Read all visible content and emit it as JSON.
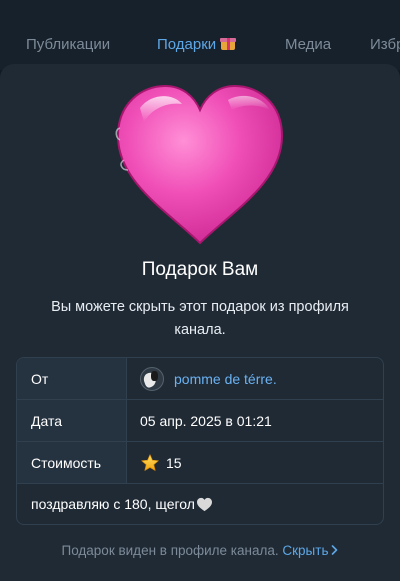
{
  "tabs": [
    {
      "label": "Публикации",
      "active": false
    },
    {
      "label": "Подарки",
      "active": true
    },
    {
      "label": "Медиа",
      "active": false
    },
    {
      "label": "Избранное",
      "active": false
    }
  ],
  "gift": {
    "icon": "pink-heart",
    "title": "Подарок Вам",
    "subtitle": "Вы можете скрыть этот подарок из профиля канала."
  },
  "details": {
    "from_label": "От",
    "from_value": "pomme de térre.",
    "date_label": "Дата",
    "date_value": "05 апр. 2025 в 01:21",
    "cost_label": "Стоимость",
    "cost_value": "15",
    "comment": "поздравляю с 180, щегол"
  },
  "footer": {
    "text": "Подарок виден в профиле канала.",
    "link": "Скрыть"
  },
  "colors": {
    "accent": "#5ea7e6",
    "heart": "#f04fb7",
    "sheet": "#1f2a35"
  }
}
